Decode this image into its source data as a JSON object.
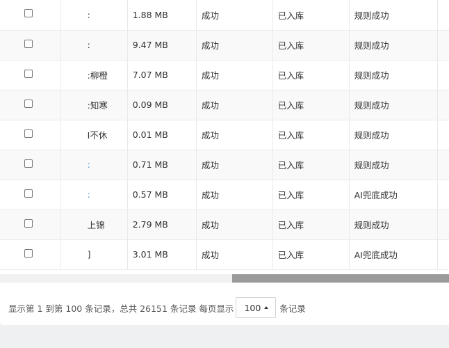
{
  "table": {
    "rows": [
      {
        "name": ":",
        "name_color": "default",
        "size": "1.88 MB",
        "status": "成功",
        "storage": "已入库",
        "rule": "规则成功"
      },
      {
        "name": ":",
        "name_color": "default",
        "size": "9.47 MB",
        "status": "成功",
        "storage": "已入库",
        "rule": "规则成功"
      },
      {
        "name": ":柳橙",
        "name_color": "default",
        "size": "7.07 MB",
        "status": "成功",
        "storage": "已入库",
        "rule": "规则成功"
      },
      {
        "name": ":知寒",
        "name_color": "default",
        "size": "0.09 MB",
        "status": "成功",
        "storage": "已入库",
        "rule": "规则成功"
      },
      {
        "name": "I不休",
        "name_color": "default",
        "size": "0.01 MB",
        "status": "成功",
        "storage": "已入库",
        "rule": "规则成功"
      },
      {
        "name": ":",
        "name_color": "link",
        "size": "0.71 MB",
        "status": "成功",
        "storage": "已入库",
        "rule": "规则成功"
      },
      {
        "name": ":",
        "name_color": "link",
        "size": "0.57 MB",
        "status": "成功",
        "storage": "已入库",
        "rule": "AI兜底成功"
      },
      {
        "name": "上锦",
        "name_color": "default",
        "size": "2.79 MB",
        "status": "成功",
        "storage": "已入库",
        "rule": "规则成功"
      },
      {
        "name": "]",
        "name_color": "default",
        "size": "3.01 MB",
        "status": "成功",
        "storage": "已入库",
        "rule": "AI兜底成功"
      }
    ]
  },
  "pagination": {
    "summary": "显示第 1 到第 100 条记录，总共 26151 条记录",
    "per_page_label": "每页显示",
    "page_size": "100",
    "suffix": "条记录"
  },
  "colors": {
    "link": "#4a8fd6",
    "border": "#e7eaec",
    "scroll_thumb": "#9b9b9b",
    "background": "#eef0f2"
  },
  "icons": {
    "page_size_caret": "caret-up-icon"
  }
}
